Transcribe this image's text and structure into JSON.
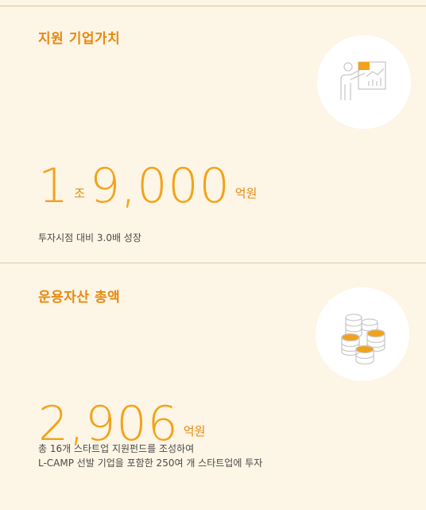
{
  "sections": [
    {
      "title": "지원 기업가치",
      "value_part1": "1",
      "unit1": "조",
      "value_part2": "9,000",
      "unit2": "억원",
      "description": [
        "투자시점 대비 3.0배 성장"
      ],
      "icon": "presentation-chart-icon"
    },
    {
      "title": "운용자산 총액",
      "value_part1": "2,906",
      "unit1": "억원",
      "description": [
        "총 16개 스타트업 지원펀드를 조성하여",
        "L-CAMP 선발 기업을 포함한 250여 개 스타트업에 투자"
      ],
      "icon": "coin-stacks-icon"
    }
  ],
  "colors": {
    "background": "#fdf5e5",
    "accent": "#e7890e",
    "number": "#f2a21a",
    "text": "#4a4a4a"
  }
}
